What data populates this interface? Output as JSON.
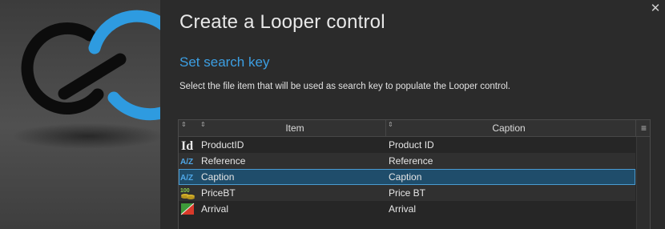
{
  "dialog": {
    "title": "Create a Looper control",
    "close_glyph": "✕",
    "step_title": "Set search key",
    "description": "Select the file item that will be used as search key to populate the Looper control."
  },
  "table": {
    "columns": [
      "Item",
      "Caption"
    ],
    "sort_glyph": "⇕",
    "menu_glyph": "≡",
    "rows": [
      {
        "icon": "id-icon",
        "icon_text": "Id",
        "item": "ProductID",
        "caption": "Product ID"
      },
      {
        "icon": "alpha-icon",
        "icon_text": "A/Z",
        "item": "Reference",
        "caption": "Reference"
      },
      {
        "icon": "alpha-icon",
        "icon_text": "A/Z",
        "item": "Caption",
        "caption": "Caption",
        "selected": true
      },
      {
        "icon": "currency-icon",
        "icon_text": "100",
        "item": "PriceBT",
        "caption": "Price BT"
      },
      {
        "icon": "date-icon",
        "icon_text": "",
        "item": "Arrival",
        "caption": "Arrival"
      }
    ]
  },
  "colors": {
    "accent": "#3c9fe3",
    "selection": "#1f4d6b",
    "background": "#2b2b2b"
  }
}
